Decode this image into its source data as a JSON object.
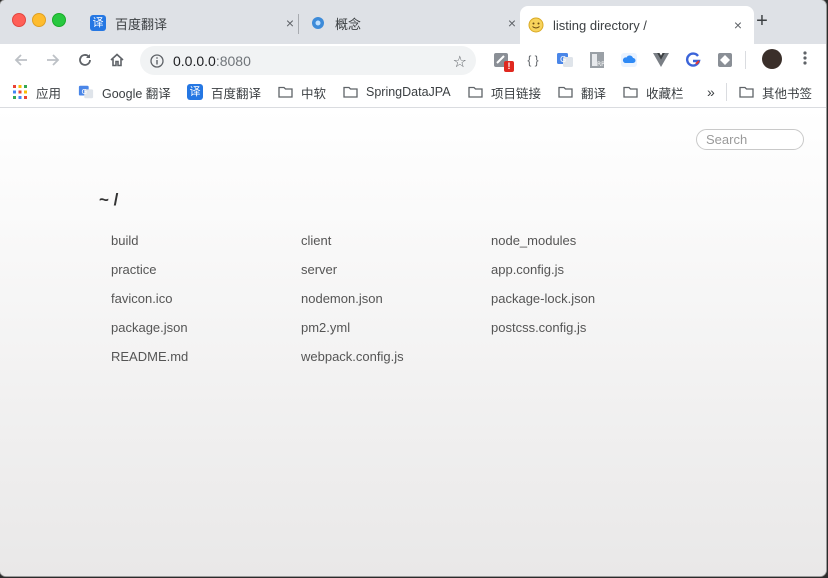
{
  "tabs": [
    {
      "title": "百度翻译",
      "favicon": "baidu-translate-icon",
      "close": "×"
    },
    {
      "title": "概念",
      "favicon": "concept-icon",
      "close": "×"
    },
    {
      "title": "listing directory /",
      "favicon": "smiley-icon",
      "close": "×",
      "active": true
    }
  ],
  "new_tab": "+",
  "toolbar": {
    "url_host": "0.0.0.0",
    "url_port": ":8080",
    "extension_badge": "!",
    "star": "☆",
    "json_ext": "{ }"
  },
  "bookmarks": [
    {
      "label": "应用",
      "icon": "apps-grid-icon"
    },
    {
      "label": "Google 翻译",
      "icon": "google-translate-icon"
    },
    {
      "label": "百度翻译",
      "icon": "baidu-translate-icon"
    },
    {
      "label": "中软",
      "icon": "folder-icon"
    },
    {
      "label": "SpringDataJPA",
      "icon": "folder-icon"
    },
    {
      "label": "项目链接",
      "icon": "folder-icon"
    },
    {
      "label": "翻译",
      "icon": "folder-icon"
    },
    {
      "label": "收藏栏",
      "icon": "folder-icon"
    }
  ],
  "bookmarks_overflow": "»",
  "other_bookmarks": "其他书签",
  "page": {
    "search_placeholder": "Search",
    "heading": "~ /",
    "files": [
      "build",
      "client",
      "node_modules",
      "practice",
      "server",
      "app.config.js",
      "favicon.ico",
      "nodemon.json",
      "package-lock.json",
      "package.json",
      "pm2.yml",
      "postcss.config.js",
      "README.md",
      "webpack.config.js"
    ]
  },
  "colors": {
    "tab_strip": "#dee1e6",
    "accent_blue": "#2577e3",
    "link": "#555555"
  }
}
